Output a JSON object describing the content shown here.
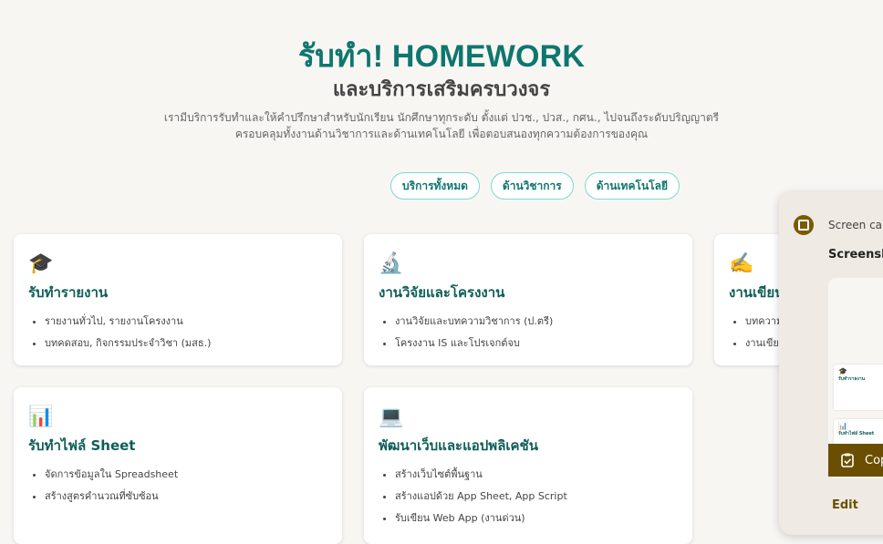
{
  "hero": {
    "title": "รับทำ! HOMEWORK",
    "subtitle": "และบริการเสริมครบวงจร",
    "desc_line1": "เรามีบริการรับทำและให้คำปรึกษาสำหรับนักเรียน นักศึกษาทุกระดับ ตั้งแต่ ปวช., ปวส., กศน., ไปจนถึงระดับปริญญาตรี",
    "desc_line2": "ครอบคลุมทั้งงานด้านวิชาการและด้านเทคโนโลยี เพื่อตอบสนองทุกความต้องการของคุณ"
  },
  "filters": [
    "บริการทั้งหมด",
    "ด้านวิชาการ",
    "ด้านเทคโนโลยี"
  ],
  "cards": [
    {
      "icon": "graduation-cap-icon",
      "emoji": "🎓",
      "title": "รับทำรายงาน",
      "items": [
        "รายงานทั่วไป, รายงานโครงงาน",
        "บทคดสอบ, กิจกรรมประจำวิชา (มสธ.)"
      ]
    },
    {
      "icon": "microscope-icon",
      "emoji": "🔬",
      "title": "งานวิจัยและโครงงาน",
      "items": [
        "งานวิจัยและบทความวิชาการ (ป.ตรี)",
        "โครงงาน IS และโปรเจกต์จบ"
      ]
    },
    {
      "icon": "writing-hand-icon",
      "emoji": "✍️",
      "title": "งานเขียน",
      "items": [
        "บทความ",
        "งานเขียน"
      ]
    },
    {
      "icon": "bar-chart-icon",
      "emoji": "📊",
      "title": "รับทำไฟล์ Sheet",
      "items": [
        "จัดการข้อมูลใน Spreadsheet",
        "สร้างสูตรคำนวณที่ซับซ้อน"
      ]
    },
    {
      "icon": "laptop-icon",
      "emoji": "💻",
      "title": "พัฒนาเว็บและแอปพลิเคชัน",
      "items": [
        "สร้างเว็บไซต์พื้นฐาน",
        "สร้างแอปด้วย App Sheet, App Script",
        "รับเขียน Web App (งานด่วน)"
      ]
    }
  ],
  "screenshot_panel": {
    "label": "Screen cap",
    "heading": "Screensho",
    "copy_label": "Cop",
    "edit_label": "Edit",
    "thumb_card1": "รับทำรายงาน",
    "thumb_card2": "รับทำไฟล์ Sheet"
  },
  "colors": {
    "accent": "#0f766e",
    "chip_border": "#7dd9cf",
    "panel_accent": "#6b4f00"
  }
}
